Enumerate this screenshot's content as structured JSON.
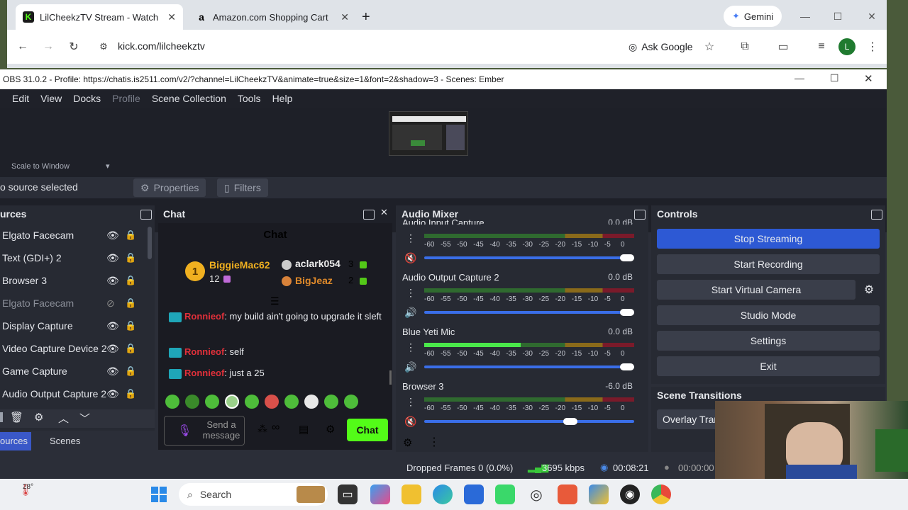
{
  "browser": {
    "tabs": [
      {
        "title": "LilCheekzTV Stream - Watch Liv",
        "favicon": "K"
      },
      {
        "title": "Amazon.com Shopping Cart",
        "favicon": "a"
      }
    ],
    "new_tab": "+",
    "gemini": "Gemini",
    "url": "kick.com/lilcheekztv",
    "ask_google": "Ask Google",
    "profile_initial": "L"
  },
  "obs": {
    "title": "OBS 31.0.2 - Profile: https://chatis.is2511.com/v2/?channel=LilCheekzTV&animate=true&size=1&font=2&shadow=3 - Scenes: Ember",
    "menu": [
      "Edit",
      "View",
      "Docks",
      "Profile",
      "Scene Collection",
      "Tools",
      "Help"
    ],
    "scale_label": "Scale to Window",
    "no_source": "o source selected",
    "properties": "Properties",
    "filters": "Filters",
    "sources": {
      "title": "urces",
      "items": [
        {
          "name": "Elgato Facecam",
          "visible": true
        },
        {
          "name": "Text (GDI+) 2",
          "visible": true
        },
        {
          "name": "Browser 3",
          "visible": true
        },
        {
          "name": "Elgato Facecam",
          "visible": false
        },
        {
          "name": "Display Capture",
          "visible": true
        },
        {
          "name": "Video Capture Device 2",
          "visible": true
        },
        {
          "name": "Game Capture",
          "visible": true
        },
        {
          "name": "Audio Output Capture 2",
          "visible": true
        }
      ],
      "tab_sources": "ources",
      "tab_scenes": "Scenes"
    },
    "chat": {
      "dock_title": "Chat",
      "header": "Chat",
      "leaders": [
        {
          "rank": "1",
          "name": "BiggieMac62",
          "count": "12"
        },
        {
          "name": "aclark054",
          "count": "3"
        },
        {
          "name": "BigJeaz",
          "count": "2"
        }
      ],
      "messages": [
        {
          "user": "Ronnieof",
          "text": ": my build ain't going to upgrade it sleft"
        },
        {
          "user": "Ronnieof",
          "text": ": self"
        },
        {
          "user": "Ronnieof",
          "text": ": just a 25"
        }
      ],
      "input_placeholder": "Send a message",
      "send": "Chat",
      "infinity": "∞"
    },
    "audio": {
      "title": "Audio Mixer",
      "channels": [
        {
          "name": "Audio Input Capture",
          "db": "0.0 dB",
          "level": 0,
          "volume": 1.0,
          "muted": true
        },
        {
          "name": "Audio Output Capture 2",
          "db": "0.0 dB",
          "level": 0,
          "volume": 1.0,
          "muted": false
        },
        {
          "name": "Blue Yeti Mic",
          "db": "0.0 dB",
          "level": 0.46,
          "volume": 1.0,
          "muted": false
        },
        {
          "name": "Browser 3",
          "db": "-6.0 dB",
          "level": 0,
          "volume": 0.73,
          "muted": true
        }
      ],
      "scale": [
        "-60",
        "-55",
        "-50",
        "-45",
        "-40",
        "-35",
        "-30",
        "-25",
        "-20",
        "-15",
        "-10",
        "-5",
        "0"
      ]
    },
    "controls": {
      "title": "Controls",
      "buttons": [
        "Stop Streaming",
        "Start Recording",
        "Start Virtual Camera",
        "Studio Mode",
        "Settings",
        "Exit"
      ]
    },
    "transitions": {
      "title": "Scene Transitions",
      "value": "Overlay Tran"
    },
    "status": {
      "dropped": "Dropped Frames 0 (0.0%)",
      "bitrate": "3695 kbps",
      "stream_time": "00:08:21",
      "rec_time": "00:00:00"
    }
  },
  "taskbar": {
    "weather": "28°",
    "search": "Search"
  }
}
